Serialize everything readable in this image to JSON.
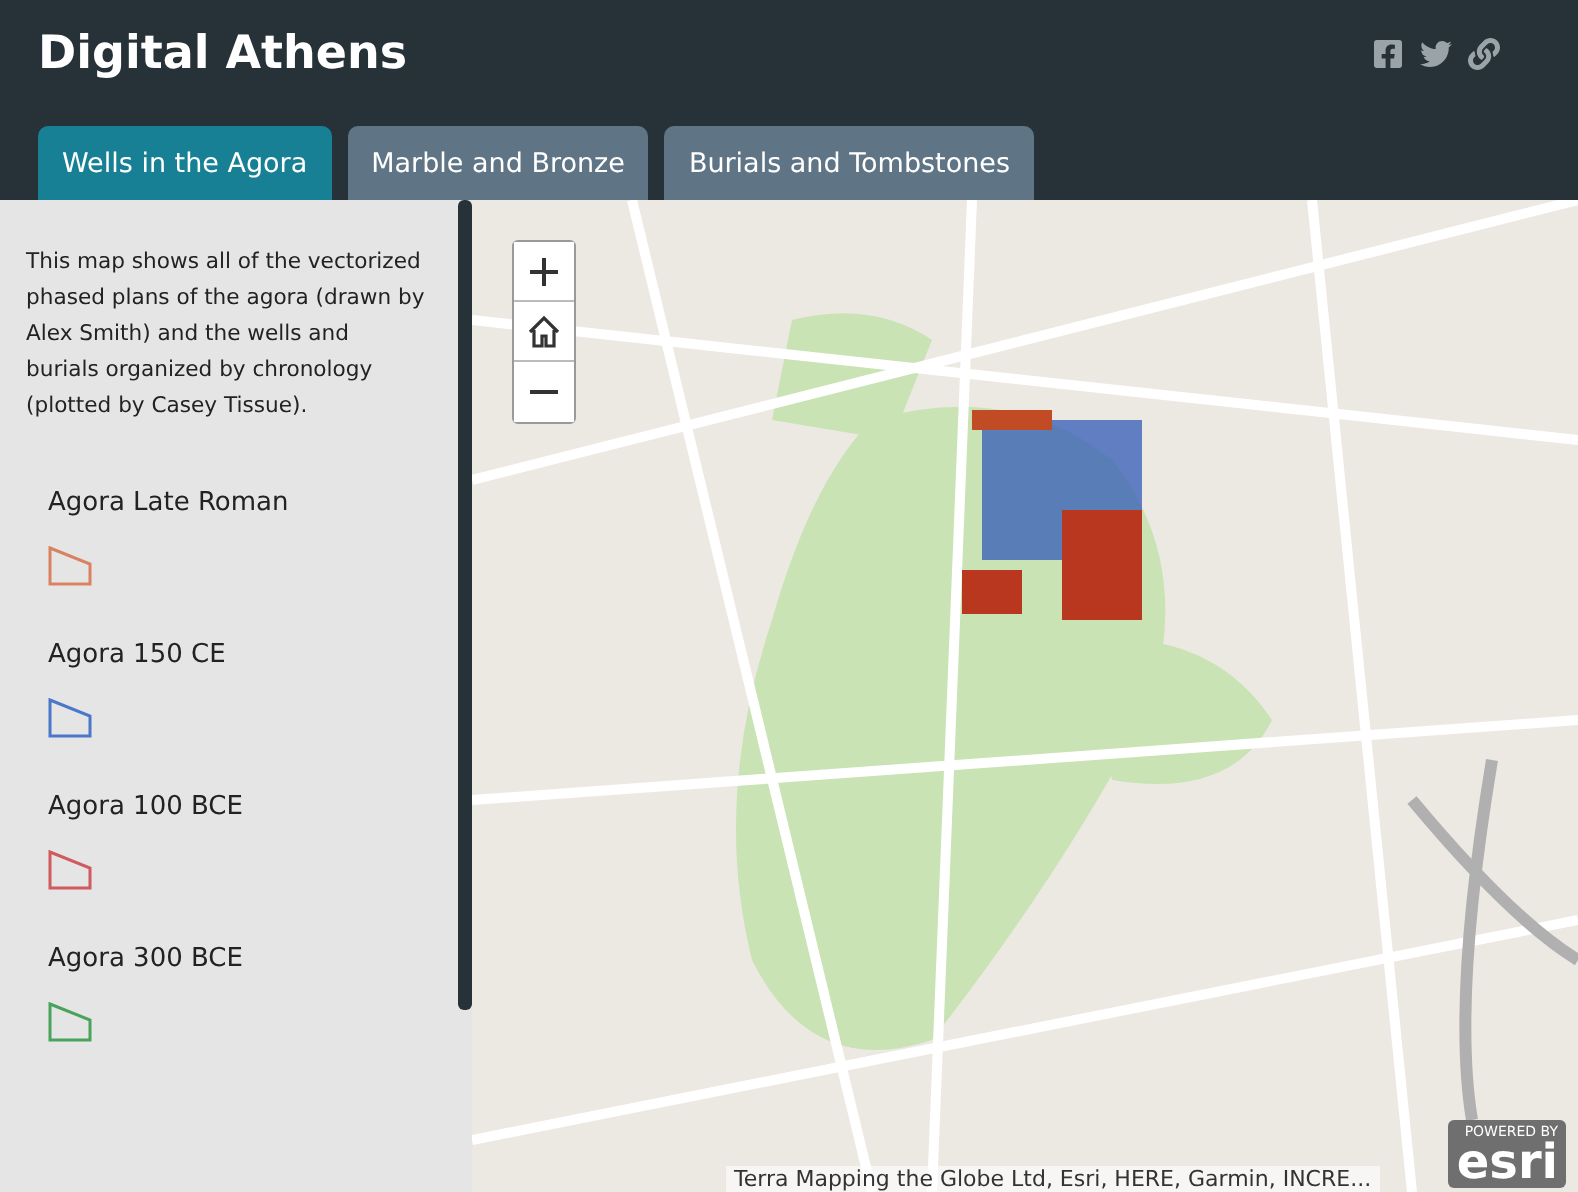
{
  "header": {
    "title": "Digital Athens"
  },
  "tabs": [
    {
      "label": "Wells in the Agora",
      "selected": true
    },
    {
      "label": "Marble and Bronze",
      "selected": false
    },
    {
      "label": "Burials and Tombstones",
      "selected": false
    }
  ],
  "sidebar": {
    "description": "This map shows all of the vectorized phased plans of the agora (drawn by Alex Smith) and the wells and burials organized by chronology (plotted by Casey Tissue).",
    "legend": [
      {
        "label": "Agora Late Roman",
        "color": "#d9825f"
      },
      {
        "label": "Agora 150 CE",
        "color": "#4a78c8"
      },
      {
        "label": "Agora 100 BCE",
        "color": "#d05a5e"
      },
      {
        "label": "Agora 300 BCE",
        "color": "#4aa35a"
      }
    ]
  },
  "map": {
    "attribution": "Terra Mapping the Globe Ltd, Esri, HERE, Garmin, INCRE...",
    "logo_caption": "POWERED BY",
    "logo": "esri"
  }
}
